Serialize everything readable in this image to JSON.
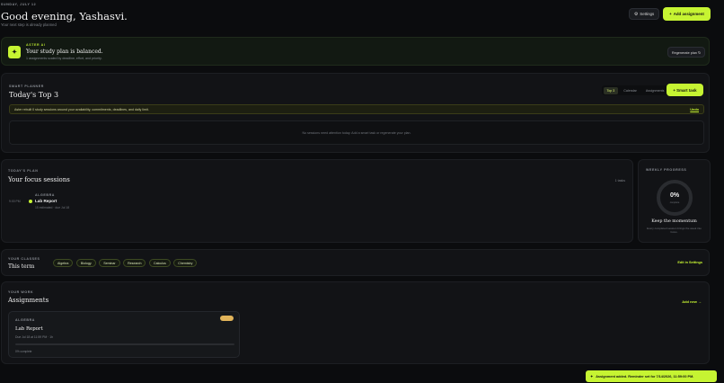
{
  "header": {
    "date": "SUNDAY, JULY 12",
    "greeting": "Good evening, Yashasvi.",
    "subtitle": "Your next step is already planned",
    "settings_label": "Settings",
    "settings_icon": "gear-icon",
    "add_assignment_label": "Add assignment",
    "add_icon": "plus-icon"
  },
  "aster": {
    "eyebrow": "ASTER AI",
    "icon": "sparkle-icon",
    "title": "Your study plan is balanced.",
    "subtitle": "1 assignments scaled by deadline, effort, and priority.",
    "regenerate_label": "Regenerate plan ↻"
  },
  "planner": {
    "eyebrow": "SMART PLANNER",
    "title": "Today's Top 3",
    "tabs": [
      {
        "label": "Top 3",
        "active": true
      },
      {
        "label": "Calendar",
        "active": false
      },
      {
        "label": "Assignments",
        "active": false
      }
    ],
    "smart_task_label": "+ Smart task",
    "notice": "Aster rebuilt 0 study sessions around your availability, commitments, deadlines, and daily limit.",
    "undo_label": "Undo",
    "empty_text": "No sessions need attention today. Add a smart task or regenerate your plan."
  },
  "today": {
    "eyebrow": "TODAY'S PLAN",
    "title": "Your focus sessions",
    "tasks_count": "1 tasks",
    "sessions": [
      {
        "time": "9:00 PM",
        "subject": "ALGEBRA",
        "title": "Lab Report",
        "meta": "15 estimated · due Jul 18"
      }
    ]
  },
  "weekly": {
    "eyebrow": "WEEKLY PROGRESS",
    "percent": "0%",
    "ring_label": "complete",
    "progress_fraction": 0,
    "title": "Keep the momentum",
    "subtitle": "Every completed session brings the week into focus."
  },
  "classes": {
    "eyebrow": "YOUR CLASSES",
    "title": "This term",
    "items": [
      "Algebra",
      "Biology",
      "Seminar",
      "Research",
      "Calculus",
      "Chemistry"
    ],
    "edit_label": "Edit in Settings"
  },
  "work": {
    "eyebrow": "YOUR WORK",
    "title": "Assignments",
    "add_new_label": "Add new →",
    "assignments": [
      {
        "subject": "ALGEBRA",
        "title": "Lab Report",
        "due": "Due Jul 18 at 11:59 PM · 1h",
        "progress": 0,
        "progress_label": "0% complete",
        "badge_color": "#e1b45a"
      }
    ]
  },
  "toast": {
    "icon": "check-icon",
    "text": "Assignment added. Reminder set for 7/14/2026, 11:59:00 PM."
  },
  "colors": {
    "accent": "#c6f432",
    "background": "#0b0c0e",
    "card": "#121316"
  }
}
